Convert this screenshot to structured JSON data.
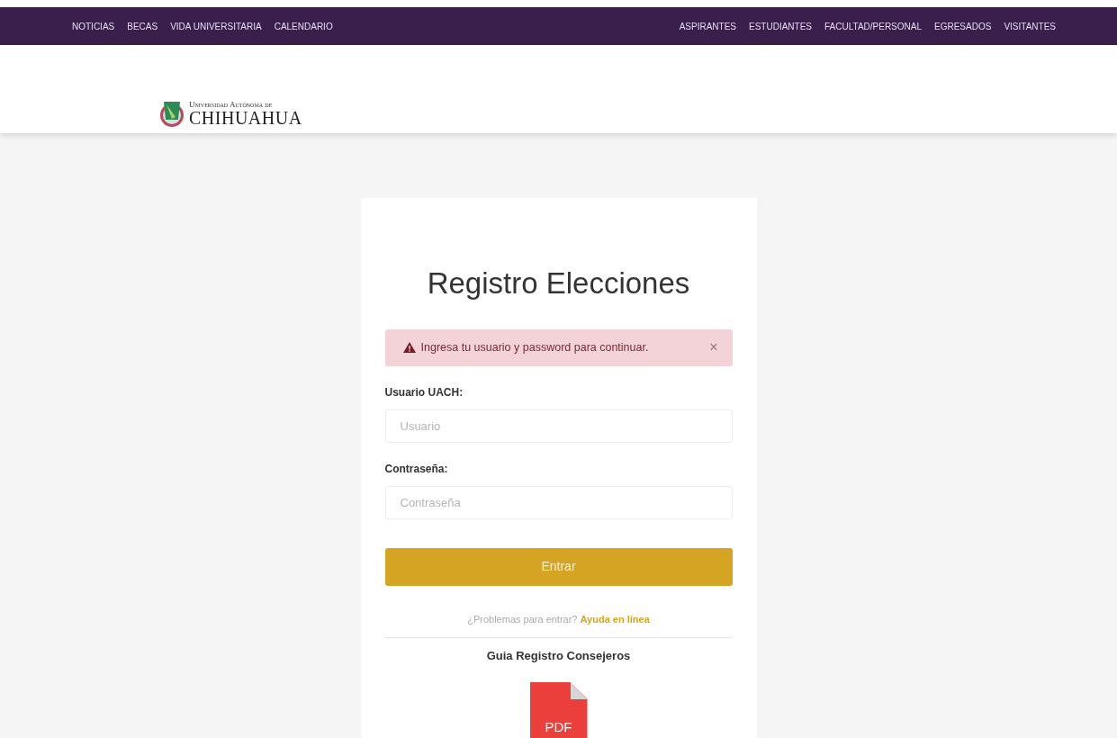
{
  "top_nav": {
    "left_links": [
      "NOTICIAS",
      "BECAS",
      "VIDA UNIVERSITARIA",
      "CALENDARIO"
    ],
    "right_links": [
      "ASPIRANTES",
      "ESTUDIANTES",
      "FACULTAD/PERSONAL",
      "EGRESADOS",
      "VISITANTES"
    ]
  },
  "logo": {
    "line_1": "Universidad Autónoma de",
    "line_2": "CHIHUAHUA"
  },
  "login_card": {
    "title": "Registro Elecciones",
    "alert": {
      "message": "Ingresa tu usuario y password para continuar.",
      "close": "×"
    },
    "fields": [
      {
        "label": "Usuario UACH:",
        "placeholder": "Usuario"
      },
      {
        "label": "Contraseña:",
        "placeholder": "Contraseña"
      }
    ],
    "submit_button": "Entrar",
    "help": {
      "text": "¿Problemas para entrar?",
      "link": "Ayuda en línea"
    },
    "guide": {
      "title": "Guia Registro Consejeros",
      "file_label": "PDF"
    }
  }
}
